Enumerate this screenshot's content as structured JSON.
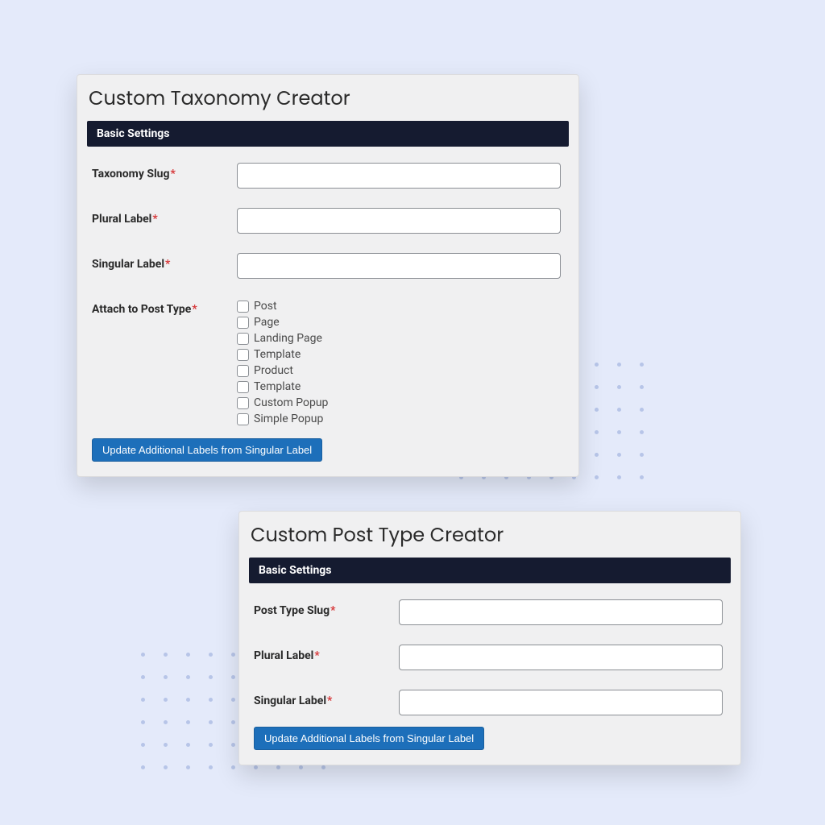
{
  "taxonomy_card": {
    "title": "Custom Taxonomy Creator",
    "section_header": "Basic Settings",
    "fields": {
      "slug": {
        "label": "Taxonomy Slug",
        "value": ""
      },
      "plural": {
        "label": "Plural Label",
        "value": ""
      },
      "singular": {
        "label": "Singular Label",
        "value": ""
      },
      "attach": {
        "label": "Attach to Post Type",
        "options": [
          "Post",
          "Page",
          "Landing Page",
          "Template",
          "Product",
          "Template",
          "Custom Popup",
          "Simple Popup"
        ]
      }
    },
    "update_button": "Update Additional Labels from Singular Label"
  },
  "posttype_card": {
    "title": "Custom Post Type Creator",
    "section_header": "Basic Settings",
    "fields": {
      "slug": {
        "label": "Post Type Slug",
        "value": ""
      },
      "plural": {
        "label": "Plural Label",
        "value": ""
      },
      "singular": {
        "label": "Singular Label",
        "value": ""
      }
    },
    "update_button": "Update Additional Labels from Singular Label"
  },
  "colors": {
    "page_bg": "#e4eafa",
    "header_bar": "#151b30",
    "button_primary": "#1d6fba",
    "required": "#d63638"
  }
}
